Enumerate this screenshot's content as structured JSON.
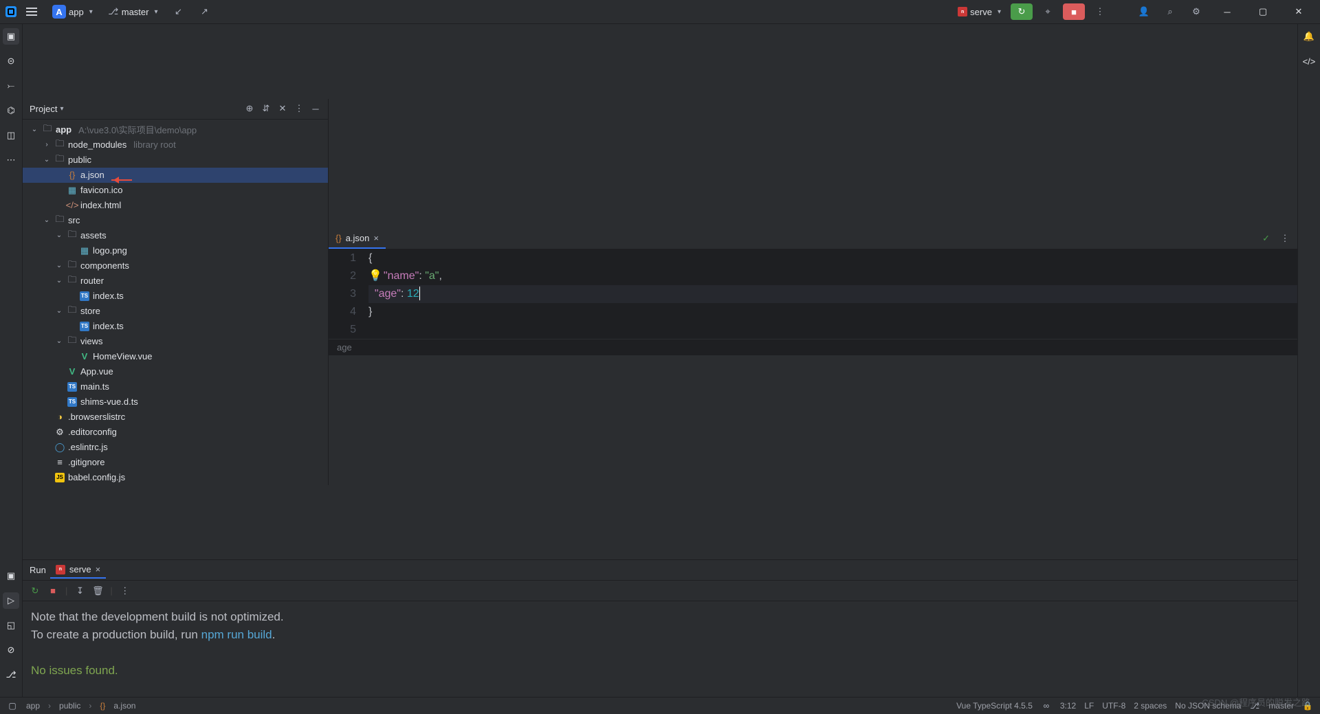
{
  "titlebar": {
    "project_badge": "A",
    "project_name": "app",
    "branch": "master",
    "run_config": "serve"
  },
  "project_panel": {
    "title": "Project",
    "root": {
      "name": "app",
      "path": "A:\\vue3.0\\实际项目\\demo\\app"
    },
    "tree": [
      {
        "depth": 1,
        "name": "node_modules",
        "info": "library root",
        "icon": "folder",
        "closed": true
      },
      {
        "depth": 1,
        "name": "public",
        "icon": "folder"
      },
      {
        "depth": 2,
        "name": "a.json",
        "icon": "json",
        "selected": true,
        "arrow": true
      },
      {
        "depth": 2,
        "name": "favicon.ico",
        "icon": "img"
      },
      {
        "depth": 2,
        "name": "index.html",
        "icon": "html"
      },
      {
        "depth": 1,
        "name": "src",
        "icon": "folder"
      },
      {
        "depth": 2,
        "name": "assets",
        "icon": "folder"
      },
      {
        "depth": 3,
        "name": "logo.png",
        "icon": "img"
      },
      {
        "depth": 2,
        "name": "components",
        "icon": "folder"
      },
      {
        "depth": 2,
        "name": "router",
        "icon": "folder"
      },
      {
        "depth": 3,
        "name": "index.ts",
        "icon": "ts"
      },
      {
        "depth": 2,
        "name": "store",
        "icon": "folder"
      },
      {
        "depth": 3,
        "name": "index.ts",
        "icon": "ts"
      },
      {
        "depth": 2,
        "name": "views",
        "icon": "folder"
      },
      {
        "depth": 3,
        "name": "HomeView.vue",
        "icon": "vue"
      },
      {
        "depth": 2,
        "name": "App.vue",
        "icon": "vue"
      },
      {
        "depth": 2,
        "name": "main.ts",
        "icon": "ts"
      },
      {
        "depth": 2,
        "name": "shims-vue.d.ts",
        "icon": "ts"
      },
      {
        "depth": 1,
        "name": ".browserslistrc",
        "icon": "dot-yellow"
      },
      {
        "depth": 1,
        "name": ".editorconfig",
        "icon": "gear"
      },
      {
        "depth": 1,
        "name": ".eslintrc.js",
        "icon": "dot-blue"
      },
      {
        "depth": 1,
        "name": ".gitignore",
        "icon": "file"
      },
      {
        "depth": 1,
        "name": "babel.config.js",
        "icon": "js"
      }
    ]
  },
  "editor": {
    "tab_file": "a.json",
    "lines": [
      "1",
      "2",
      "3",
      "4",
      "5"
    ],
    "code": {
      "l1": "{",
      "l2_key": "\"name\"",
      "l2_val": "\"a\"",
      "l3_key": "\"age\"",
      "l3_val": "12",
      "l4": "}"
    },
    "breadcrumb": "age"
  },
  "run": {
    "title": "Run",
    "tab": "serve",
    "console": {
      "line1": "Note that the development build is not optimized.",
      "line2a": "To create a production build, run ",
      "line2b": "npm run build",
      "line2c": ".",
      "line3": "No issues found."
    }
  },
  "status": {
    "crumb1": "app",
    "crumb2": "public",
    "crumb3": "a.json",
    "lang": "Vue TypeScript 4.5.5",
    "pos": "3:12",
    "eol": "LF",
    "enc": "UTF-8",
    "indent": "2 spaces",
    "schema": "No JSON schema",
    "branch": "master"
  },
  "watermark": "CSDN @程序员的脱发之路"
}
